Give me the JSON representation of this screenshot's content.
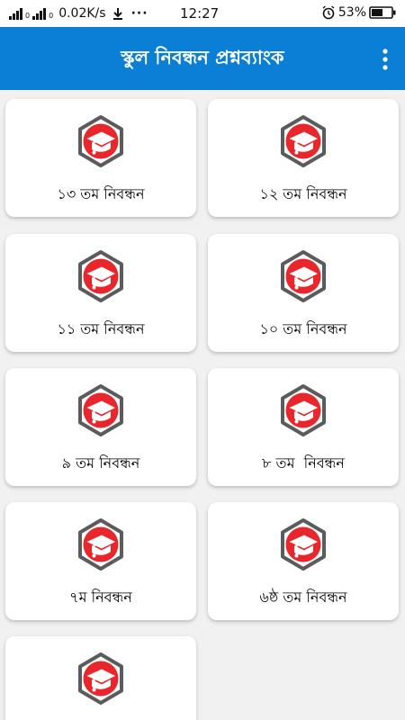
{
  "status_bar": {
    "net_speed": "0.02K/s",
    "sim_small_1": "0",
    "sim_small_2": "H",
    "sim_small_3": "0",
    "more": "···",
    "time": "12:27",
    "battery": "53%"
  },
  "app_bar": {
    "title": "স্কুল নিবন্ধন প্রশ্নব্যাংক",
    "menu_icon": "overflow-menu-icon"
  },
  "cards": [
    {
      "label": "১৩ তম নিবন্ধন",
      "icon": "graduation-cap-icon"
    },
    {
      "label": "১২ তম নিবন্ধন",
      "icon": "graduation-cap-icon"
    },
    {
      "label": "১১ তম নিবন্ধন",
      "icon": "graduation-cap-icon"
    },
    {
      "label": "১০ তম নিবন্ধন",
      "icon": "graduation-cap-icon"
    },
    {
      "label": "৯ তম নিবন্ধন",
      "icon": "graduation-cap-icon"
    },
    {
      "label": "৮ তম  নিবন্ধন",
      "icon": "graduation-cap-icon"
    },
    {
      "label": "৭ম নিবন্ধন",
      "icon": "graduation-cap-icon"
    },
    {
      "label": "৬ষ্ঠ তম নিবন্ধন",
      "icon": "graduation-cap-icon"
    },
    {
      "label": "",
      "icon": "graduation-cap-icon"
    }
  ],
  "colors": {
    "app_bar": "#0b7fd6",
    "icon_red": "#e8262b",
    "hexagon": "#5b5b5b"
  }
}
